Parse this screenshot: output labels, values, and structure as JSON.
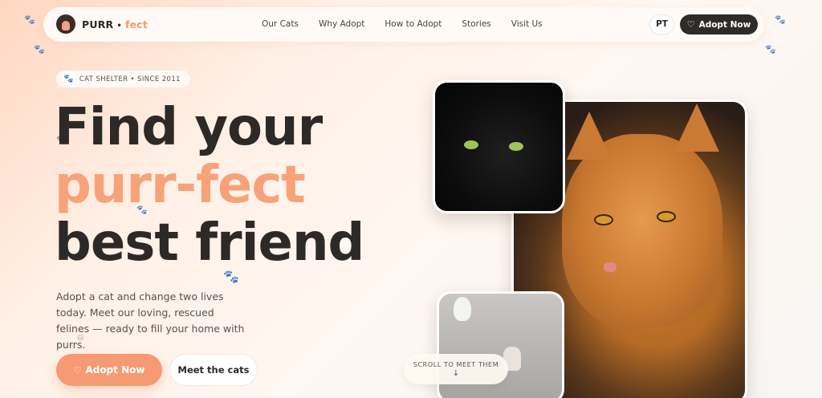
{
  "brand": {
    "name": "PURR",
    "separator": "•",
    "accent": "fect",
    "accent_color": "#f59a6c"
  },
  "nav": {
    "items": [
      {
        "label": "Our Cats"
      },
      {
        "label": "Why Adopt"
      },
      {
        "label": "How to Adopt"
      },
      {
        "label": "Stories"
      },
      {
        "label": "Visit Us"
      }
    ],
    "lang": "PT",
    "cta": "Adopt Now"
  },
  "hero": {
    "badge": "CAT SHELTER • SINCE 2011",
    "headline_line1": "Find your",
    "headline_line2": "purr-fect",
    "headline_line3": "best friend",
    "description": "Adopt a cat and change two lives today. Meet our loving, rescued felines — ready to fill your home with purrs.",
    "primary_button": "Adopt Now",
    "secondary_button": "Meet the cats"
  },
  "scroll": {
    "label": "SCROLL TO MEET THEM",
    "arrow": "↓"
  },
  "icons": {
    "paw": "paw-icon",
    "heart": "heart-icon",
    "logo": "cat-logo-icon",
    "badge": "paw-badge-icon"
  },
  "colors": {
    "accent": "#f59a72",
    "dark": "#2f2b29"
  }
}
